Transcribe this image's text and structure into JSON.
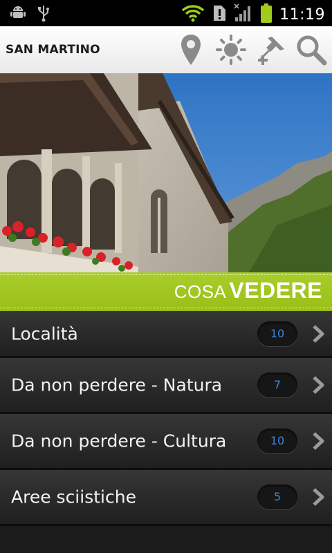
{
  "status_bar": {
    "time": "11:19",
    "icons": [
      "android-debug-icon",
      "usb-icon",
      "wifi-icon",
      "notification-alert-icon",
      "signal-icon",
      "battery-icon"
    ]
  },
  "action_bar": {
    "title": "SAN MARTINO",
    "actions": [
      "map-pin-icon",
      "weather-sun-icon",
      "add-pin-icon",
      "search-icon"
    ]
  },
  "section": {
    "title_light": "COSA",
    "title_bold": "VEDERE",
    "accent_color": "#a3c81f"
  },
  "list": {
    "items": [
      {
        "label": "Località",
        "count": "10"
      },
      {
        "label": "Da non perdere - Natura",
        "count": "7"
      },
      {
        "label": "Da non perdere - Cultura",
        "count": "10"
      },
      {
        "label": "Aree sciistiche",
        "count": "5"
      }
    ],
    "badge_text_color": "#3b86e0"
  }
}
